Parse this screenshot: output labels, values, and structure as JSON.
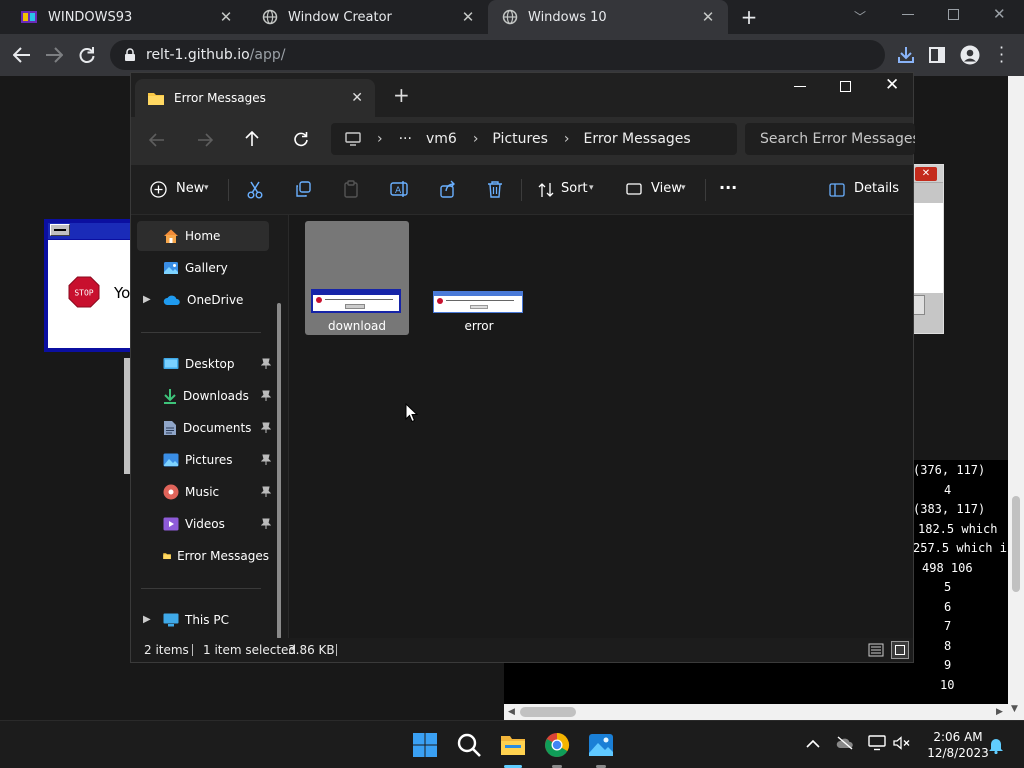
{
  "browser": {
    "tabs": [
      {
        "title": "WINDOWS93",
        "active": false
      },
      {
        "title": "Window Creator",
        "active": false
      },
      {
        "title": "Windows 10",
        "active": true
      }
    ],
    "url_host": "relt-1.github.io",
    "url_path": "/app/"
  },
  "page": {
    "win93_msg": "Yo",
    "stop_text": "STOP",
    "terminal_lines": [
      "(376, 117)",
      "4",
      "(383, 117)",
      "182.5 which ",
      "257.5 which i",
      "498 106",
      "5",
      "6",
      "7",
      "8",
      "9",
      "10"
    ]
  },
  "explorer": {
    "tab_title": "Error Messages",
    "breadcrumb": {
      "more": "···",
      "items": [
        "vm6",
        "Pictures",
        "Error Messages"
      ]
    },
    "search_placeholder": "Search Error Messages",
    "commands": {
      "new": "New",
      "sort": "Sort",
      "view": "View",
      "more": "···",
      "details": "Details"
    },
    "sidebar": {
      "top": [
        "Home",
        "Gallery",
        "OneDrive"
      ],
      "pinned": [
        "Desktop",
        "Downloads",
        "Documents",
        "Pictures",
        "Music",
        "Videos",
        "Error Messages"
      ],
      "bottom": [
        "This PC"
      ]
    },
    "files": [
      {
        "name": "download",
        "selected": true
      },
      {
        "name": "error",
        "selected": false
      }
    ],
    "status": {
      "count": "2 items",
      "selection": "1 item selected",
      "size": "3.86 KB"
    }
  },
  "taskbar": {
    "time": "2:06 AM",
    "date": "12/8/2023"
  },
  "colors": {
    "accent": "#0078d4",
    "folder": "#f9c845",
    "win93_blue": "#0b0fa0"
  }
}
